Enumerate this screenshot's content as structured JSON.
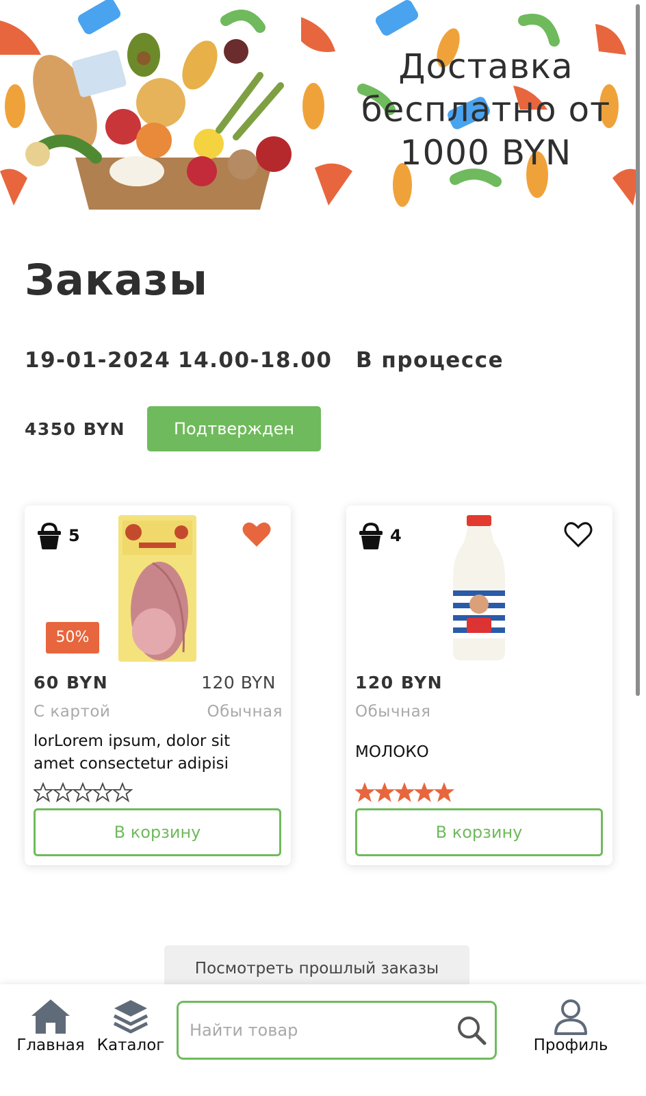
{
  "banner": {
    "title_lines": [
      "Доставка",
      "бесплатно от",
      "1000 BYN"
    ]
  },
  "page": {
    "title": "Заказы"
  },
  "order": {
    "date": "19-01-2024",
    "time": "14.00-18.00",
    "status": "В процессе",
    "total": "4350 BYN",
    "confirm_label": "Подтвержден"
  },
  "products": [
    {
      "basket_count": "5",
      "favorite": true,
      "discount": "50%",
      "price": "60 BYN",
      "price_label": "С картой",
      "old_price": "120 BYN",
      "old_price_label": "Обычная",
      "name": "lorLorem ipsum, dolor sit amet consectetur adipisi",
      "rating": 0,
      "cart_label": "В корзину"
    },
    {
      "basket_count": "4",
      "favorite": false,
      "price": "120 BYN",
      "price_label": "Обычная",
      "name": "МОЛОКО",
      "rating": 5,
      "cart_label": "В корзину"
    }
  ],
  "past_orders_label": "Посмотреть прошлый заказы",
  "nav": {
    "home_label": "Главная",
    "catalog_label": "Каталог",
    "search_placeholder": "Найти товар",
    "profile_label": "Профиль"
  },
  "colors": {
    "accent_green": "#6fba5c",
    "accent_orange": "#e8663d"
  },
  "icons": [
    "basket-icon",
    "heart-icon",
    "star-icon",
    "home-icon",
    "catalog-icon",
    "search-icon",
    "profile-icon"
  ]
}
